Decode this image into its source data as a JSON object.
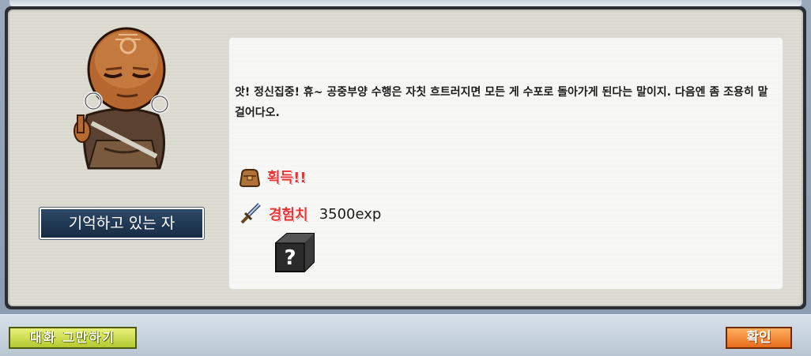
{
  "npc": {
    "name": "기억하고 있는 자",
    "portrait": "monk-npc-portrait"
  },
  "dialog": {
    "text": "앗! 정신집중! 휴~ 공중부양 수행은 자칫 흐트러지면 모든 게 수포로 돌아가게 된다는 말이지. 다음엔 좀 조용히 말 걸어다오."
  },
  "rewards": {
    "acquire_label": "획득!!",
    "acquire_icon": "bag-icon",
    "exp_label": "경험치",
    "exp_icon": "sword-icon",
    "exp_value": "3500exp",
    "item_icon": "question-box-icon"
  },
  "buttons": {
    "end_chat": "대화 그만하기",
    "confirm": "확인"
  },
  "colors": {
    "accent_red": "#e83434",
    "confirm_orange": "#e86b1c",
    "end_chat_green": "#b4c930",
    "npc_button_navy": "#172c44"
  }
}
